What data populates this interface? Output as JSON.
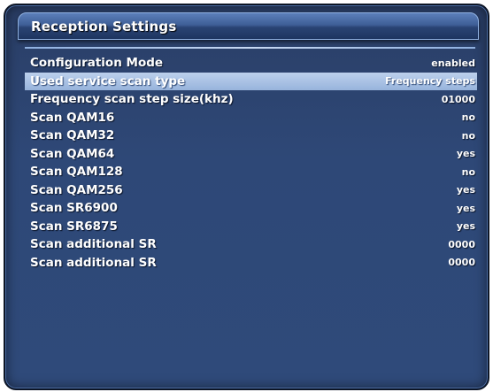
{
  "window": {
    "title": "Reception Settings"
  },
  "settings": [
    {
      "label": "Configuration Mode",
      "value": "enabled",
      "selected": false
    },
    {
      "label": "Used service scan type",
      "value": "Frequency steps",
      "selected": true
    },
    {
      "label": "Frequency scan step size(khz)",
      "value": "01000",
      "selected": false
    },
    {
      "label": "Scan QAM16",
      "value": "no",
      "selected": false
    },
    {
      "label": "Scan QAM32",
      "value": "no",
      "selected": false
    },
    {
      "label": "Scan QAM64",
      "value": "yes",
      "selected": false
    },
    {
      "label": "Scan QAM128",
      "value": "no",
      "selected": false
    },
    {
      "label": "Scan QAM256",
      "value": "yes",
      "selected": false
    },
    {
      "label": "Scan SR6900",
      "value": "yes",
      "selected": false
    },
    {
      "label": "Scan SR6875",
      "value": "yes",
      "selected": false
    },
    {
      "label": "Scan additional SR",
      "value": "0000",
      "selected": false
    },
    {
      "label": "Scan additional SR",
      "value": "0000",
      "selected": false
    }
  ],
  "colors": {
    "panel_background": "#2f4a7a",
    "selection_highlight": "#a9c2e6",
    "text": "#ffffff"
  }
}
